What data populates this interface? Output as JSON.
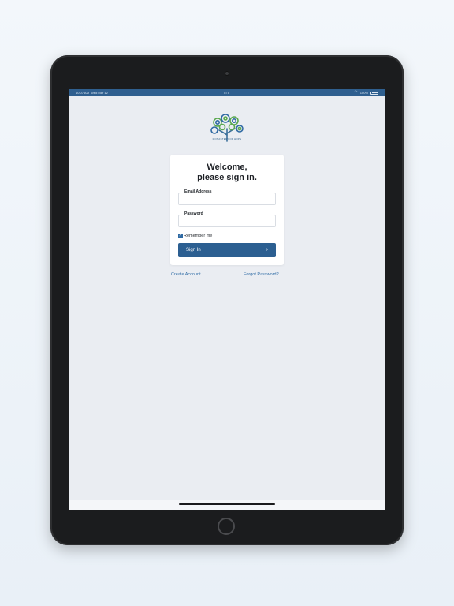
{
  "status_bar": {
    "time": "10:07 AM",
    "date": "Wed Mar 12",
    "center_dots": "•••",
    "battery": "100%"
  },
  "logo": {
    "caption": "MONASTERY OF HOPE",
    "icon": "tree-logo-icon"
  },
  "signin_card": {
    "title_line1": "Welcome,",
    "title_line2": "please sign in.",
    "email_label": "Email Address",
    "email_value": "",
    "password_label": "Password",
    "password_value": "",
    "remember_label": "Remember me",
    "remember_checked": true,
    "signin_label": "Sign In"
  },
  "links": {
    "create_account": "Create Account",
    "forgot_password": "Forgot Password?"
  },
  "colors": {
    "accent": "#2c5f91",
    "status_bar": "#2f5f8f",
    "link": "#3570a8"
  }
}
